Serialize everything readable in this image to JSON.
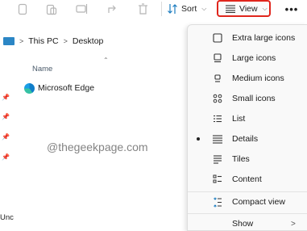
{
  "toolbar": {
    "icons": [
      "copy-icon",
      "paste-icon",
      "rename-icon",
      "share-icon",
      "delete-icon"
    ],
    "sort_label": "Sort",
    "view_label": "View",
    "more_label": "•••"
  },
  "breadcrumb": {
    "root": "This PC",
    "current": "Desktop"
  },
  "file_list": {
    "column_name": "Name",
    "items": [
      {
        "name": "Microsoft Edge",
        "icon": "edge-icon"
      }
    ],
    "left_cut_text": "Unc"
  },
  "watermark": "@thegeekpage.com",
  "view_menu": {
    "items": [
      {
        "label": "Extra large icons",
        "icon": "extra-large-icons-icon",
        "selected": false
      },
      {
        "label": "Large icons",
        "icon": "large-icons-icon",
        "selected": false
      },
      {
        "label": "Medium icons",
        "icon": "medium-icons-icon",
        "selected": false
      },
      {
        "label": "Small icons",
        "icon": "small-icons-icon",
        "selected": false
      },
      {
        "label": "List",
        "icon": "list-icon",
        "selected": false
      },
      {
        "label": "Details",
        "icon": "details-icon",
        "selected": true
      },
      {
        "label": "Tiles",
        "icon": "tiles-icon",
        "selected": false
      },
      {
        "label": "Content",
        "icon": "content-icon",
        "selected": false
      },
      {
        "label": "Compact view",
        "icon": "compact-view-icon",
        "selected": false
      },
      {
        "label": "Show",
        "icon": "",
        "selected": false,
        "has_submenu": true
      }
    ]
  },
  "colors": {
    "highlight_border": "#e0261d",
    "menu_bg": "#f9f9f9",
    "accent": "#2b86c5"
  }
}
